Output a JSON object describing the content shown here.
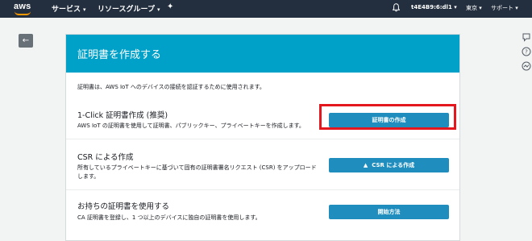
{
  "nav": {
    "logo": "aws",
    "services": "サービス",
    "resource_groups": "リソースグループ",
    "account": "t4E4B9:6:dl1",
    "region": "東京",
    "support": "サポート"
  },
  "page": {
    "title": "証明書を作成する",
    "intro": "証明書は、AWS IoT へのデバイスの接続を認証するために使用されます。"
  },
  "sections": [
    {
      "title": "1-Click 証明書作成 (推奨)",
      "desc": "AWS IoT の証明書を使用して証明書、パブリックキー、プライベートキーを作成します。",
      "button": "証明書の作成"
    },
    {
      "title": "CSR による作成",
      "desc": "所有しているプライベートキーに基づいて固有の証明書署名リクエスト (CSR) をアップロードします。",
      "button": "CSR による作成"
    },
    {
      "title": "お持ちの証明書を使用する",
      "desc": "CA 証明書を登録し、1 つ以上のデバイスに独自の証明書を使用します。",
      "button": "開始方法"
    }
  ],
  "colors": {
    "nav_bg": "#232f3e",
    "header_bg": "#00a1c9",
    "button_bg": "#1f8ebe",
    "highlight": "#e3171d"
  }
}
